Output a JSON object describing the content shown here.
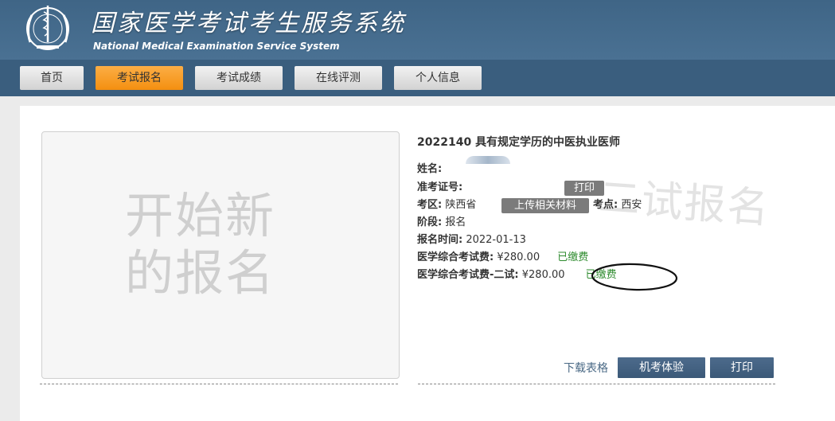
{
  "header": {
    "title": "国家医学考试考生服务系统",
    "subtitle": "National Medical Examination Service System"
  },
  "nav": {
    "items": [
      "首页",
      "考试报名",
      "考试成绩",
      "在线评测",
      "个人信息"
    ],
    "active_index": 1
  },
  "start_panel": {
    "text": "开始新的报名"
  },
  "exam": {
    "title": "2022140 具有规定学历的中医执业医师",
    "name_label": "姓名:",
    "admission_label": "准考证号:",
    "admission_print": "打印",
    "region_label": "考区:",
    "region_value": "陕西省",
    "upload_button": "上传相关材料",
    "site_label": "考点:",
    "site_value": "西安",
    "stage_label": "阶段:",
    "stage_value": "报名",
    "reg_time_label": "报名时间:",
    "reg_time_value": "2022-01-13",
    "fee1_label": "医学综合考试费:",
    "fee1_value": "¥280.00",
    "fee1_status": "已缴费",
    "fee2_label": "医学综合考试费-二试:",
    "fee2_value": "¥280.00",
    "fee2_status": "已缴费",
    "watermark": "二试报名"
  },
  "actions": {
    "download": "下载表格",
    "trial": "机考体验",
    "print": "打印"
  },
  "colors": {
    "header_bg": "#3f6586",
    "nav_bg": "#3a5e7e",
    "active_tab": "#f7a02c",
    "paid_green": "#2e8b2e",
    "dark_button": "#3f5e7e"
  }
}
